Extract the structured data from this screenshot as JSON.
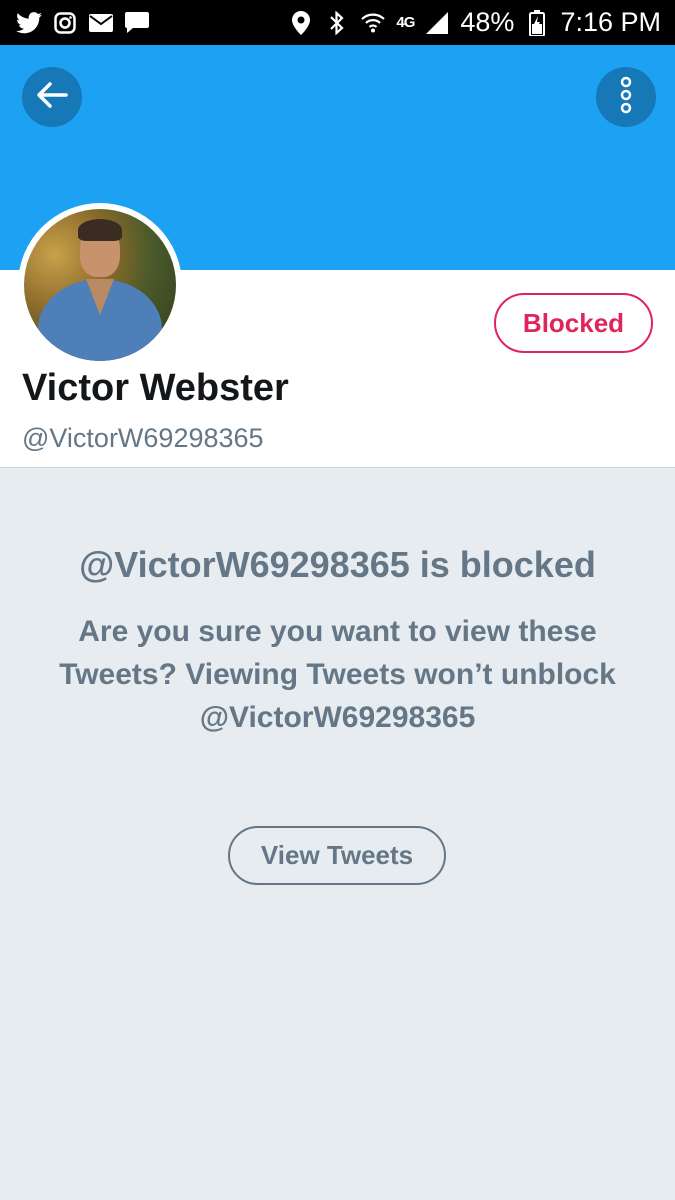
{
  "status_bar": {
    "icons_left": [
      "twitter-icon",
      "instagram-icon",
      "mail-icon",
      "message-icon"
    ],
    "icons_right": [
      "location-icon",
      "bluetooth-icon",
      "wifi-icon",
      "signal-icon",
      "battery-icon"
    ],
    "network": "4G",
    "battery": "48%",
    "time": "7:16 PM"
  },
  "header": {
    "back_icon": "arrow-left-icon",
    "more_icon": "more-vertical-icon",
    "banner_color": "#1da1f2"
  },
  "profile": {
    "name": "Victor Webster",
    "handle": "@VictorW69298365",
    "blocked_label": "Blocked",
    "accent_color": "#e0245e"
  },
  "blocked_notice": {
    "title": "@VictorW69298365 is blocked",
    "description": "Are you sure you want to view these Tweets? Viewing Tweets won’t unblock @VictorW69298365",
    "view_button_label": "View Tweets"
  }
}
